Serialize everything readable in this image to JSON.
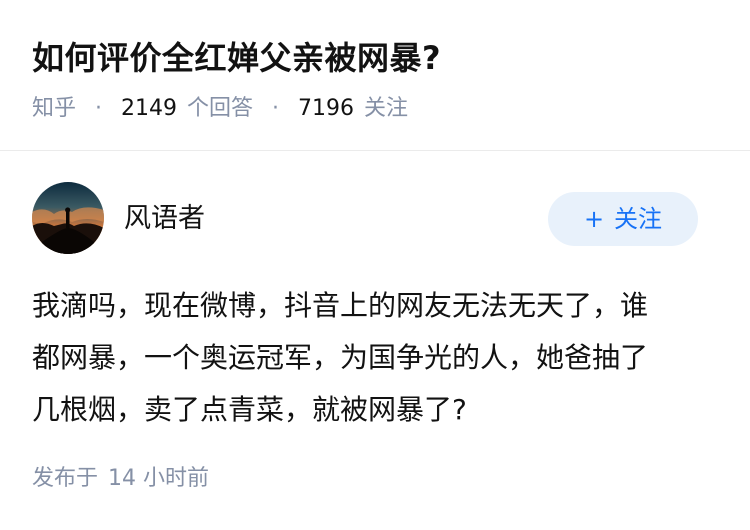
{
  "question": {
    "title": "如何评价全红婵父亲被网暴?",
    "source": "知乎",
    "answer_count": "2149",
    "answer_label": "个回答",
    "follower_count": "7196",
    "follower_label": "关注",
    "separator": "·"
  },
  "answer": {
    "author": {
      "name": "风语者",
      "avatar_icon": "sunset-silhouette-avatar"
    },
    "follow_button": {
      "icon": "+",
      "label": "关注"
    },
    "content_lines": [
      "我滴吗，现在微博，抖音上的网友无法无天了，谁",
      "都网暴，一个奥运冠军，为国争光的人，她爸抽了",
      "几根烟，卖了点青菜，就被网暴了?"
    ],
    "publish": {
      "prefix": "发布于",
      "time": "14 小时前"
    }
  },
  "colors": {
    "accent": "#1772f6",
    "follow_bg": "#e8f1fb",
    "meta_gray": "#8590a6",
    "text": "#121212"
  }
}
